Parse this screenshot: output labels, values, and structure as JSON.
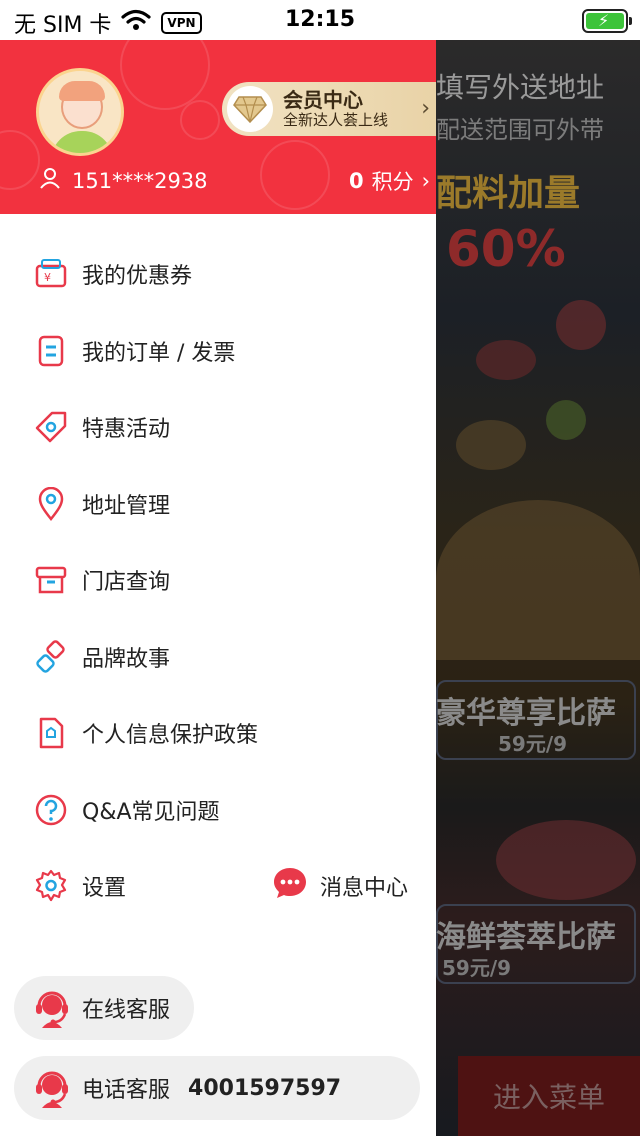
{
  "status_bar": {
    "carrier": "无 SIM 卡",
    "vpn": "VPN",
    "time": "12:15"
  },
  "header": {
    "member_title": "会员中心",
    "member_subtitle": "全新达人荟上线",
    "phone": "151****2938",
    "points_value": "0",
    "points_label": "积分"
  },
  "menu": {
    "items": [
      {
        "label": "我的优惠券",
        "icon": "coupon-wallet-icon"
      },
      {
        "label": "我的订单 / 发票",
        "icon": "order-doc-icon"
      },
      {
        "label": "特惠活动",
        "icon": "tag-icon"
      },
      {
        "label": "地址管理",
        "icon": "location-pin-icon"
      },
      {
        "label": "门店查询",
        "icon": "store-icon"
      },
      {
        "label": "品牌故事",
        "icon": "link-shapes-icon"
      },
      {
        "label": "个人信息保护政策",
        "icon": "policy-doc-icon"
      },
      {
        "label": "Q&A常见问题",
        "icon": "question-icon"
      },
      {
        "label": "设置",
        "icon": "gear-icon"
      }
    ],
    "message_center": "消息中心"
  },
  "service": {
    "online_label": "在线客服",
    "phone_label": "电话客服",
    "phone_number": "4001597597"
  },
  "background": {
    "line1": "填写外送地址",
    "line2": "配送范围可外带",
    "line3": "配料加量",
    "line4": "60%",
    "line5": "豪华尊享比萨",
    "line6": "59元/9",
    "line7": "海鲜荟萃比萨",
    "line8": "59元/9",
    "enter_menu": "进入菜单"
  },
  "colors": {
    "brand_red": "#f2323f",
    "icon_red": "#e8394a",
    "icon_blue": "#23a4e0"
  }
}
